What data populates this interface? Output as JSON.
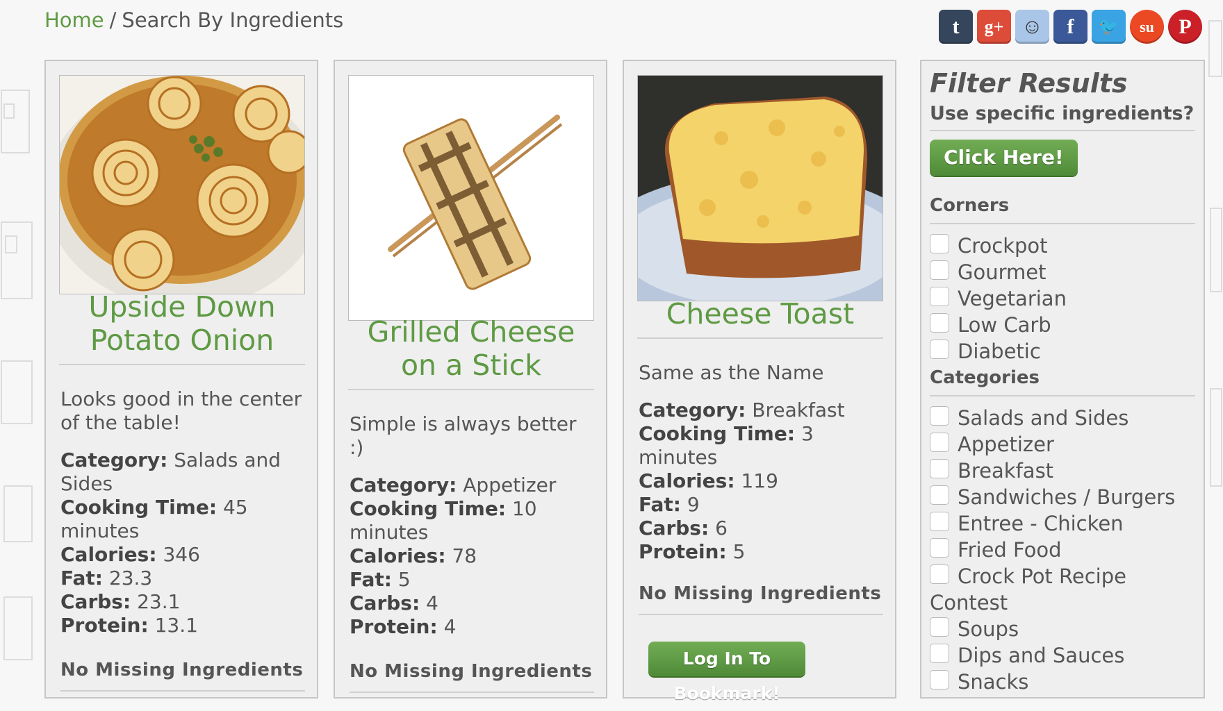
{
  "breadcrumb": {
    "home": "Home",
    "separator": "/",
    "current": "Search By Ingredients"
  },
  "social": [
    {
      "name": "tumblr-icon",
      "glyph": "t",
      "color": "#35465c"
    },
    {
      "name": "google-plus-icon",
      "glyph": "g+",
      "color": "#dd4b39"
    },
    {
      "name": "reddit-icon",
      "glyph": "☺",
      "color": "#a9c6e8"
    },
    {
      "name": "facebook-icon",
      "glyph": "f",
      "color": "#3b5998"
    },
    {
      "name": "twitter-icon",
      "glyph": "🐦",
      "color": "#3aa3e3"
    },
    {
      "name": "stumbleupon-icon",
      "glyph": "su",
      "color": "#eb4924"
    },
    {
      "name": "pinterest-icon",
      "glyph": "P",
      "color": "#cb2027"
    }
  ],
  "recipes": [
    {
      "title": "Upside Down Potato Onion",
      "description": "Looks good in the center of the table!",
      "category_label": "Category:",
      "category": "Salads and Sides",
      "time_label": "Cooking Time:",
      "time": "45 minutes",
      "calories_label": "Calories:",
      "calories": "346",
      "fat_label": "Fat:",
      "fat": "23.3",
      "carbs_label": "Carbs:",
      "carbs": "23.1",
      "protein_label": "Protein:",
      "protein": "13.1",
      "missing": "No Missing Ingredients"
    },
    {
      "title": "Grilled Cheese on a Stick",
      "description": "Simple is always better :)",
      "category_label": "Category:",
      "category": "Appetizer",
      "time_label": "Cooking Time:",
      "time": "10 minutes",
      "calories_label": "Calories:",
      "calories": "78",
      "fat_label": "Fat:",
      "fat": "5",
      "carbs_label": "Carbs:",
      "carbs": "4",
      "protein_label": "Protein:",
      "protein": "4",
      "missing": "No Missing Ingredients"
    },
    {
      "title": "Cheese Toast",
      "description": "Same as the Name",
      "category_label": "Category:",
      "category": "Breakfast",
      "time_label": "Cooking Time:",
      "time": "3 minutes",
      "calories_label": "Calories:",
      "calories": "119",
      "fat_label": "Fat:",
      "fat": "9",
      "carbs_label": "Carbs:",
      "carbs": "6",
      "protein_label": "Protein:",
      "protein": "5",
      "missing": "No Missing Ingredients"
    }
  ],
  "bookmark_button": "Log In To Bookmark!",
  "filter": {
    "title": "Filter Results",
    "subtitle": "Use specific ingredients?",
    "click_here": "Click Here!",
    "corners_label": "Corners",
    "corners": [
      "Crockpot",
      "Gourmet",
      "Vegetarian",
      "Low Carb",
      "Diabetic"
    ],
    "categories_label": "Categories",
    "categories": [
      "Salads and Sides",
      "Appetizer",
      "Breakfast",
      "Sandwiches / Burgers",
      "Entree - Chicken",
      "Fried Food",
      "Crock Pot Recipe Contest",
      "Soups",
      "Dips and Sauces",
      "Snacks"
    ]
  },
  "colors": {
    "accent_green": "#5e9a43",
    "button_green": "#4f8a38",
    "panel": "#efefef"
  }
}
